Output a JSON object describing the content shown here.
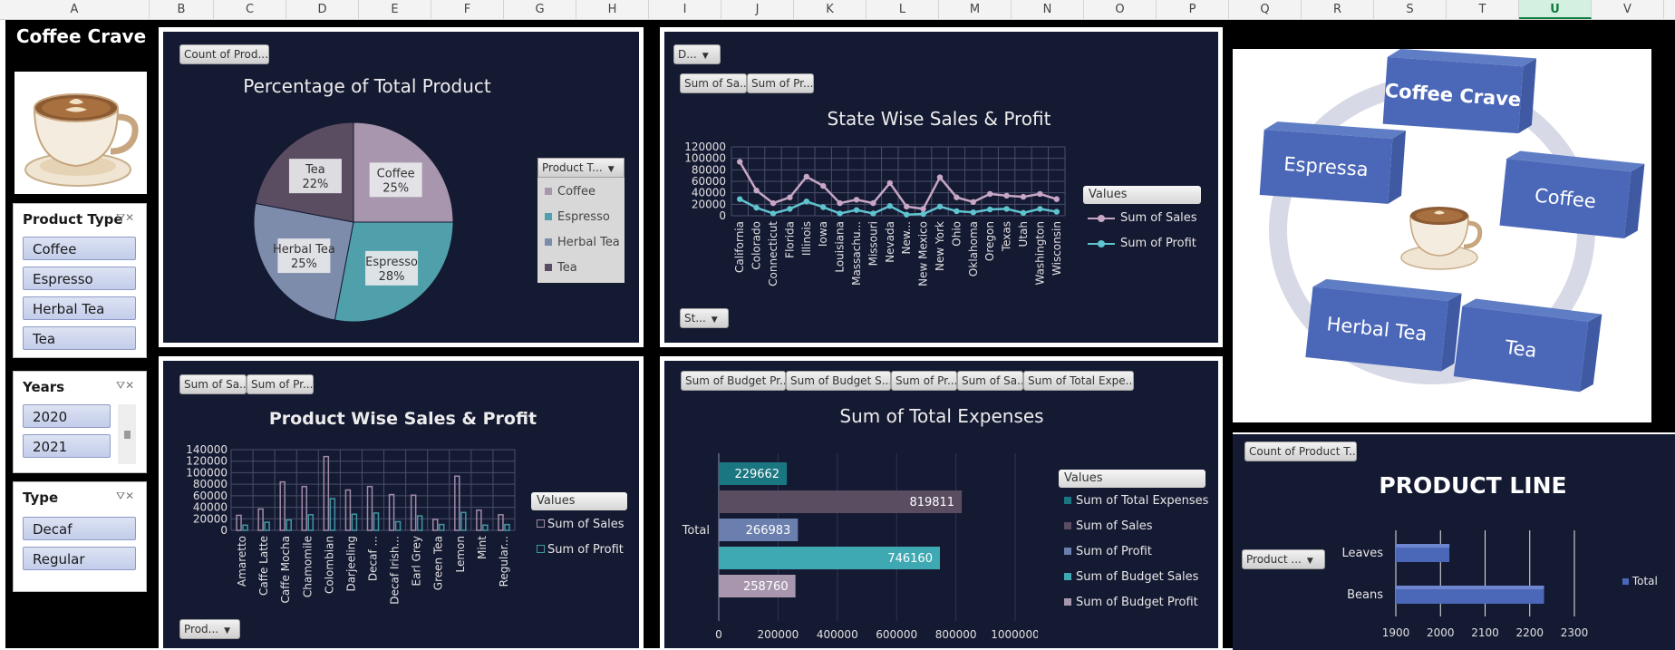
{
  "columns": [
    "A",
    "B",
    "C",
    "D",
    "E",
    "F",
    "G",
    "H",
    "I",
    "J",
    "K",
    "L",
    "M",
    "N",
    "O",
    "P",
    "Q",
    "R",
    "S",
    "T",
    "U",
    "V"
  ],
  "selected_column": "U",
  "sidebar": {
    "title": "Coffee Crave",
    "product_type": {
      "title": "Product Type",
      "items": [
        "Coffee",
        "Espresso",
        "Herbal Tea",
        "Tea"
      ]
    },
    "years": {
      "title": "Years",
      "items": [
        "2020",
        "2021"
      ]
    },
    "type": {
      "title": "Type",
      "items": [
        "Decaf",
        "Regular"
      ]
    }
  },
  "pie": {
    "field_button": "Count of Prod...",
    "legend_button": "Product T...",
    "chart_data": {
      "type": "pie",
      "title": "Percentage of Total Product",
      "categories": [
        "Coffee",
        "Espresso",
        "Herbal Tea",
        "Tea"
      ],
      "values": [
        25,
        28,
        25,
        22
      ],
      "value_labels": [
        "25%",
        "28%",
        "25%",
        "22%"
      ],
      "colors": [
        "#a796ad",
        "#4fa0ab",
        "#7d8cab",
        "#5a4c61"
      ]
    }
  },
  "state": {
    "top_button": "D...",
    "value_buttons": [
      "Sum of Sa...",
      "Sum of Pr..."
    ],
    "bottom_button": "St...",
    "legend_title": "Values",
    "chart_data": {
      "type": "line",
      "title": "State Wise Sales & Profit",
      "categories": [
        "California",
        "Colorado",
        "Connecticut",
        "Florida",
        "Illinois",
        "Iowa",
        "Louisiana",
        "Massachu...",
        "Missouri",
        "Nevada",
        "New...",
        "New Mexico",
        "New York",
        "Ohio",
        "Oklahoma",
        "Oregon",
        "Texas",
        "Utah",
        "Washington",
        "Wisconsin"
      ],
      "ylim": [
        0,
        120000
      ],
      "yticks": [
        "120000",
        "100000",
        "80000",
        "60000",
        "40000",
        "20000",
        "0"
      ],
      "series": [
        {
          "name": "Sum of Sales",
          "color": "#c7a7c5",
          "values": [
            94000,
            44000,
            22000,
            32000,
            68000,
            52000,
            22000,
            28000,
            22000,
            57000,
            16000,
            12000,
            67000,
            32000,
            24000,
            38000,
            35000,
            33000,
            38000,
            29000
          ]
        },
        {
          "name": "Sum of Profit",
          "color": "#5fc4cf",
          "values": [
            29000,
            14000,
            4000,
            12000,
            25000,
            15000,
            4000,
            10000,
            4000,
            17000,
            2000,
            3000,
            16000,
            8000,
            6000,
            11000,
            12000,
            5000,
            12000,
            7000
          ]
        }
      ]
    }
  },
  "product": {
    "value_buttons": [
      "Sum of Sa...",
      "Sum of Pr..."
    ],
    "bottom_button": "Prod...",
    "legend_title": "Values",
    "chart_data": {
      "type": "bar",
      "title": "Product Wise Sales & Profit",
      "categories": [
        "Amaretto",
        "Caffe Latte",
        "Caffe Mocha",
        "Chamomile",
        "Colombian",
        "Darjeeling",
        "Decaf ...",
        "Decaf Irish...",
        "Earl Grey",
        "Green Tea",
        "Lemon",
        "Mint",
        "Regular..."
      ],
      "ylim": [
        0,
        140000
      ],
      "yticks": [
        "140000",
        "120000",
        "100000",
        "80000",
        "60000",
        "40000",
        "20000",
        "0"
      ],
      "series": [
        {
          "name": "Sum of Sales",
          "color": "#a08aa6",
          "values": [
            26000,
            37000,
            84000,
            76000,
            128000,
            70000,
            76000,
            62000,
            61000,
            19000,
            94000,
            35000,
            27000
          ]
        },
        {
          "name": "Sum of Profit",
          "color": "#3f97a3",
          "values": [
            9000,
            14000,
            18000,
            27000,
            55000,
            28000,
            30000,
            15000,
            25000,
            10000,
            31000,
            9000,
            10000
          ]
        }
      ]
    }
  },
  "expenses": {
    "value_buttons": [
      "Sum of Budget Pr...",
      "Sum of Budget S...",
      "Sum of Pr...",
      "Sum of Sa...",
      "Sum of Total Expe..."
    ],
    "legend_title": "Values",
    "chart_data": {
      "type": "bar",
      "title": "Sum of Total Expenses",
      "category": "Total",
      "xlim": [
        0,
        1000000
      ],
      "xticks": [
        "0",
        "200000",
        "400000",
        "600000",
        "800000",
        "1000000"
      ],
      "series": [
        {
          "name": "Sum of Total Expenses",
          "color": "#1a7680",
          "value": 229662,
          "label": "229662"
        },
        {
          "name": "Sum of Sales",
          "color": "#5a4c61",
          "value": 819811,
          "label": "819811"
        },
        {
          "name": "Sum of Profit",
          "color": "#6a7fad",
          "value": 266983,
          "label": "266983"
        },
        {
          "name": "Sum of Budget Sales",
          "color": "#3fa9b3",
          "value": 746160,
          "label": "746160"
        },
        {
          "name": "Sum of Budget Profit",
          "color": "#a796ad",
          "value": 258760,
          "label": "258760"
        }
      ]
    }
  },
  "diagram": {
    "boxes": [
      "Coffee Crave",
      "Espressa",
      "Coffee",
      "Herbal Tea",
      "Tea"
    ]
  },
  "product_line": {
    "field_button": "Count of Product T...",
    "axis_button": "Product ...",
    "legend": "Total",
    "chart_data": {
      "type": "bar",
      "title": "PRODUCT LINE",
      "categories": [
        "Leaves",
        "Beans"
      ],
      "values": [
        2020,
        2232
      ],
      "xlim": [
        1900,
        2300
      ],
      "xticks": [
        "1900",
        "2000",
        "2100",
        "2200",
        "2300"
      ]
    }
  }
}
